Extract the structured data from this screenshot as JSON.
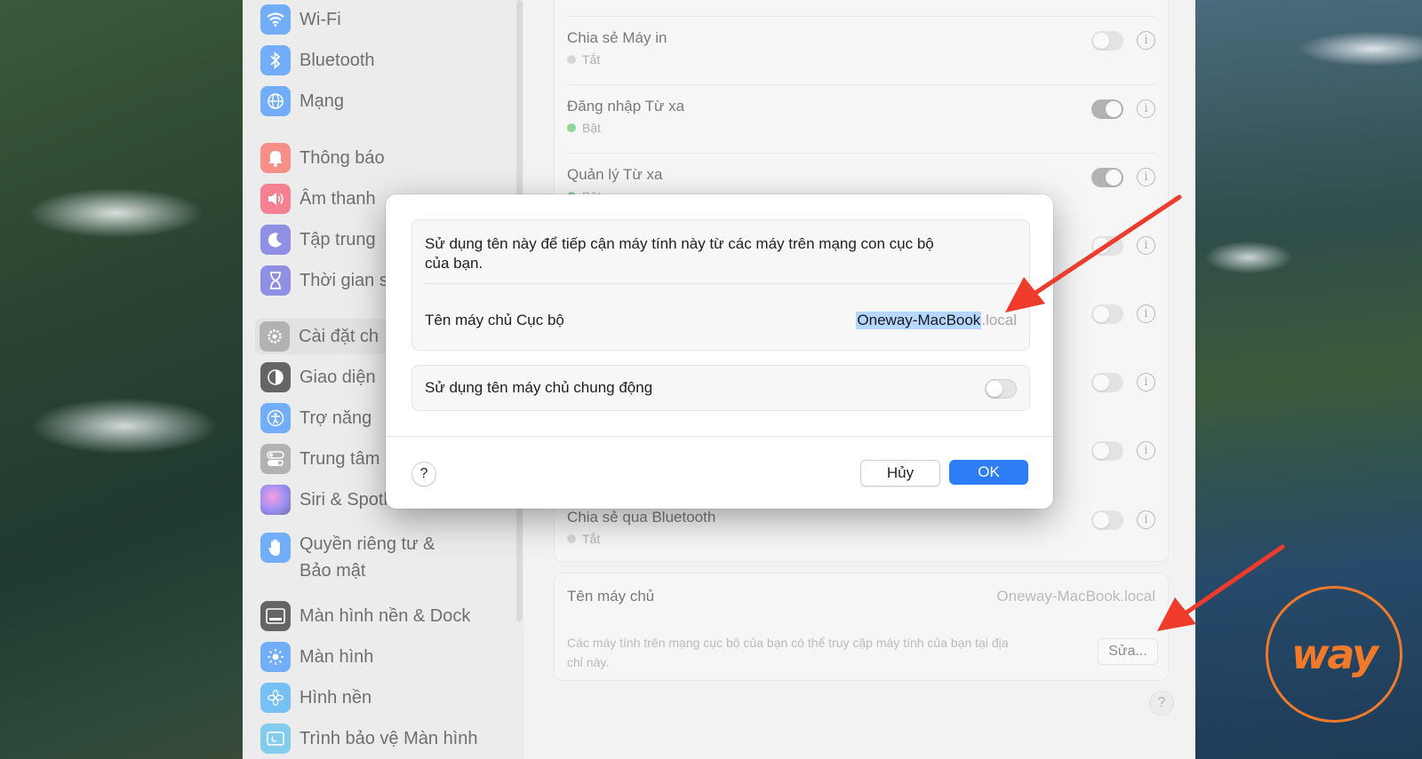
{
  "sidebar": {
    "items": [
      {
        "label": "Wi-Fi",
        "icon": "wifi-icon",
        "color": "#2f86f6"
      },
      {
        "label": "Bluetooth",
        "icon": "bluetooth-icon",
        "color": "#2f86f6"
      },
      {
        "label": "Mạng",
        "icon": "globe-icon",
        "color": "#2f86f6"
      },
      {
        "label": "Thông báo",
        "icon": "bell-icon",
        "color": "#f05b4e"
      },
      {
        "label": "Âm thanh",
        "icon": "speaker-icon",
        "color": "#f0445e"
      },
      {
        "label": "Tập trung",
        "icon": "moon-icon",
        "color": "#5b5bd6"
      },
      {
        "label": "Thời gian s",
        "icon": "hourglass-icon",
        "color": "#5b5bd6"
      },
      {
        "label": "Cài đặt ch",
        "icon": "gear-icon",
        "color": "#8e8e93"
      },
      {
        "label": "Giao diện",
        "icon": "appearance-icon",
        "color": "#1c1c1e"
      },
      {
        "label": "Trợ năng",
        "icon": "accessibility-icon",
        "color": "#2f86f6"
      },
      {
        "label": "Trung tâm",
        "icon": "control-center-icon",
        "color": "#8e8e93"
      },
      {
        "label": "Siri & Spotlight",
        "icon": "siri-icon",
        "color": "#b05ae0"
      },
      {
        "label": "Quyền riêng tư &",
        "label2": "Bảo mật",
        "icon": "hand-icon",
        "color": "#2f86f6"
      },
      {
        "label": "Màn hình nền & Dock",
        "icon": "dock-icon",
        "color": "#1c1c1e"
      },
      {
        "label": "Màn hình",
        "icon": "display-icon",
        "color": "#2f86f6"
      },
      {
        "label": "Hình nền",
        "icon": "wallpaper-icon",
        "color": "#35a3f0"
      },
      {
        "label": "Trình bảo vệ Màn hình",
        "icon": "screensaver-icon",
        "color": "#4bb4e6"
      }
    ]
  },
  "sharing": {
    "rows": [
      {
        "title": "Chia sẻ Máy in",
        "status": "Tắt",
        "on": false
      },
      {
        "title": "Đăng nhập Từ xa",
        "status": "Bật",
        "on": true
      },
      {
        "title": "Quản lý Từ xa",
        "status": "Bật",
        "on": true
      },
      {
        "title": "Chia sẻ qua Bluetooth",
        "status": "Tắt",
        "on": false
      }
    ],
    "info_glyph": "i"
  },
  "hostname_card": {
    "label": "Tên máy chủ",
    "value": "Oneway-MacBook.local",
    "description_line1": "Các máy tính trên mạng cục bộ của bạn có thể truy cập máy tính của bạn tại địa",
    "description_line2": "chỉ này.",
    "edit_button": "Sửa..."
  },
  "help_glyph": "?",
  "dialog": {
    "description_line1": "Sử dụng tên này để tiếp cận máy tính này từ các máy trên mạng con cục bộ",
    "description_line2": "của bạn.",
    "local_hostname_label": "Tên máy chủ Cục bộ",
    "local_hostname_value": "Oneway-MacBook",
    "local_hostname_suffix": ".local",
    "dynamic_label": "Sử dụng tên máy chủ chung động",
    "dynamic_on": false,
    "help": "?",
    "cancel": "Hủy",
    "ok": "OK"
  },
  "accent_color": "#2e7cf6",
  "annotation_color": "#ee3b2b",
  "logo": {
    "text": "way",
    "color": "#f07a2a"
  }
}
